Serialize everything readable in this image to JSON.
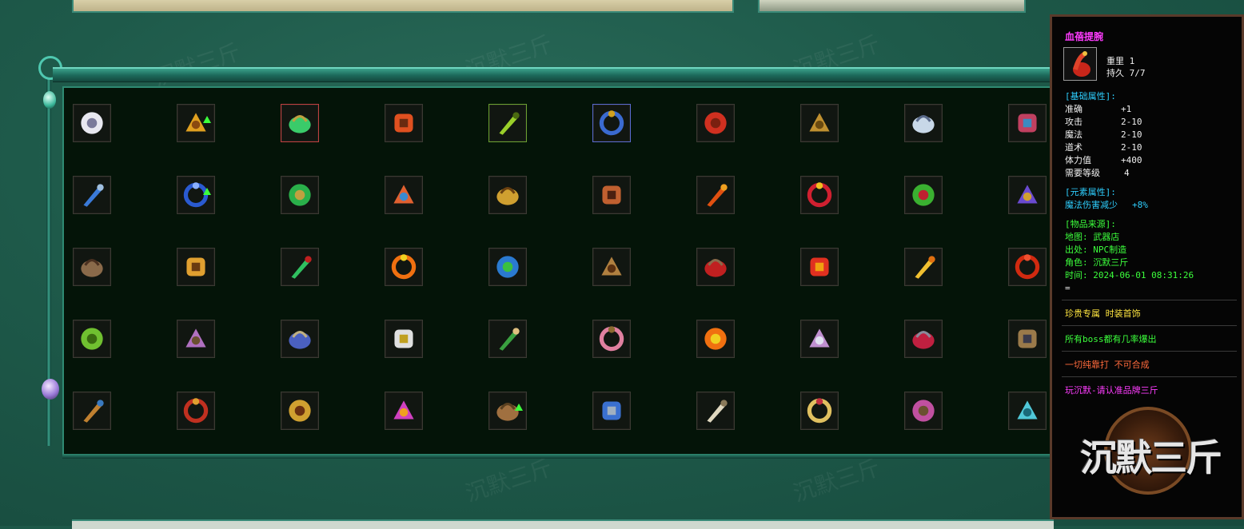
{
  "watermark_text": "沉默三斤",
  "inventory": {
    "rows": [
      [
        "compass-charm-icon",
        "crown-icon",
        "jade-helmet-icon",
        "dragon-blade-icon",
        "gold-medal-icon",
        "blue-medal-icon",
        "axe-icon",
        "sword-icon",
        "silver-bracelet-icon",
        "jeweled-armlet-icon"
      ],
      [
        "blue-bracer-icon",
        "blue-beast-icon",
        "green-amulet-icon",
        "feather-fan-icon",
        "golden-hammer-icon",
        "ruby-ring-icon",
        "dragon-ring-icon",
        "fortune-shield-icon",
        "green-leaf-icon",
        "purple-armor-icon"
      ],
      [
        "leather-boots-icon",
        "golden-figure-icon",
        "jade-bracelet-icon",
        "fire-handcuffs-icon",
        "earth-orb-icon",
        "ornate-belt-icon",
        "red-boots-icon",
        "flame-emblem-icon",
        "golden-flower-icon",
        "red-gourd-icon"
      ],
      [
        "green-beetle-icon",
        "amethyst-ring-icon",
        "sapphire-gem-icon",
        "feather-wreath-icon",
        "green-tassel-icon",
        "flower-basket-icon",
        "fire-essence-icon",
        "silver-coil-icon",
        "claw-weapon-icon",
        "dark-ring-icon"
      ],
      [
        "bronze-disc-icon",
        "treasure-chest-icon",
        "golden-boots-icon",
        "fairy-wings-icon",
        "bronze-helmet-icon",
        "sapphire-ring-icon",
        "bone-claw-icon",
        "gemstone-ring-icon",
        "dark-crystal-ring-icon",
        "aqua-stone-icon"
      ]
    ],
    "upgrade_slots": [
      [
        0,
        1
      ],
      [
        1,
        1
      ],
      [
        4,
        4
      ]
    ]
  },
  "tooltip": {
    "title": "血蓓提腕",
    "weight": "重里 1",
    "durability": "持久 7/7",
    "base_header": "[基础属性]:",
    "base_stats": [
      {
        "label": "准确",
        "value": "+1"
      },
      {
        "label": "攻击",
        "value": "2-10"
      },
      {
        "label": "魔法",
        "value": "2-10"
      },
      {
        "label": "道术",
        "value": "2-10"
      },
      {
        "label": "体力值",
        "value": "+400"
      },
      {
        "label": "需要等级",
        "value": "4"
      }
    ],
    "element_header": "[元素属性]:",
    "element_label": "魔法伤害减少",
    "element_value": "+8%",
    "source_header": "[物品来源]:",
    "source_lines": [
      "地图: 武器店",
      "出处: NPC制造",
      "角色: 沉默三斤",
      "时间: 2024-06-01 08:31:26",
      "="
    ],
    "note1": "珍贵专属 时装首饰",
    "note2": "所有boss都有几率爆出",
    "note3": "一切纯靠打 不可合成",
    "note4": "玩沉默-请认准品牌三斤",
    "logo_text": "沉默三斤"
  }
}
